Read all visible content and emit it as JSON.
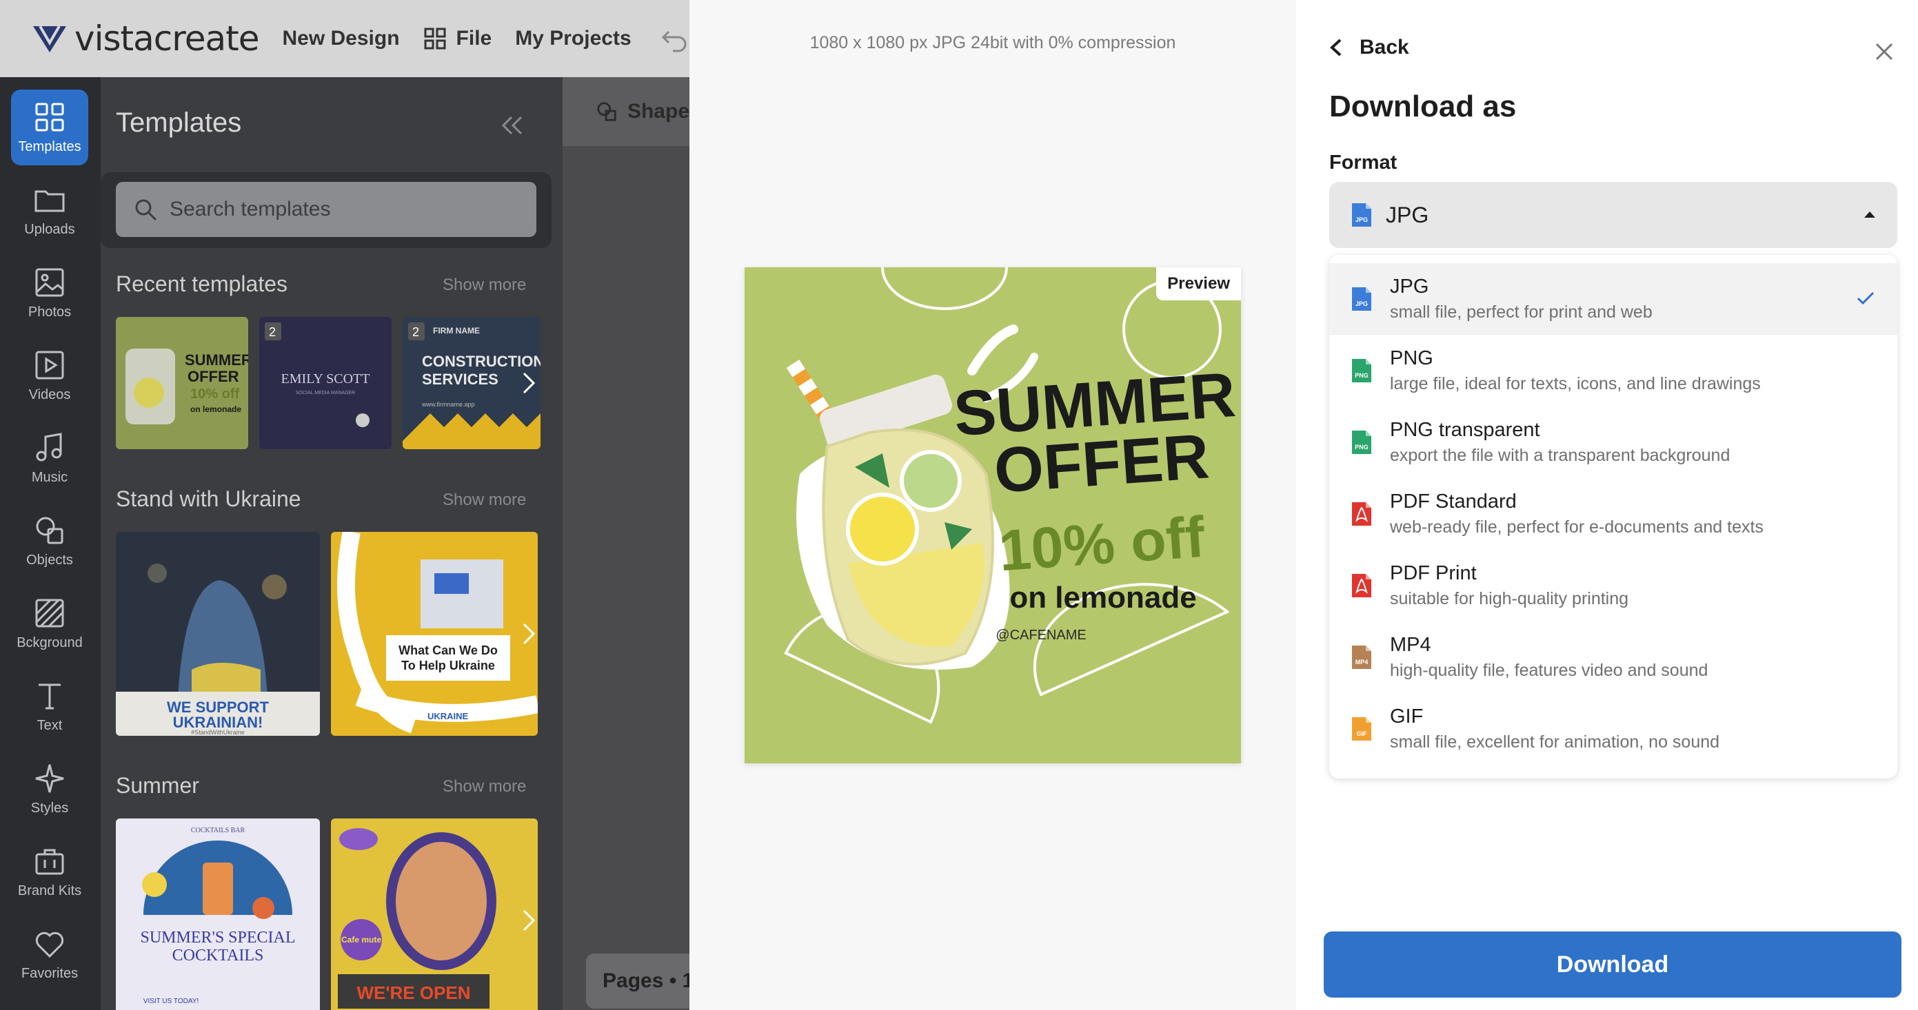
{
  "topbar": {
    "logo_text": "vistacreate",
    "new_design": "New Design",
    "file": "File",
    "my_projects": "My Projects"
  },
  "rail": [
    {
      "label": "Templates",
      "icon": "templates-icon",
      "active": true
    },
    {
      "label": "Uploads",
      "icon": "folder-icon"
    },
    {
      "label": "Photos",
      "icon": "photo-icon"
    },
    {
      "label": "Videos",
      "icon": "video-icon"
    },
    {
      "label": "Music",
      "icon": "music-icon"
    },
    {
      "label": "Objects",
      "icon": "objects-icon"
    },
    {
      "label": "Bckground",
      "icon": "background-icon"
    },
    {
      "label": "Text",
      "icon": "text-icon"
    },
    {
      "label": "Styles",
      "icon": "styles-icon"
    },
    {
      "label": "Brand Kits",
      "icon": "brand-kit-icon"
    },
    {
      "label": "Favorites",
      "icon": "heart-icon"
    }
  ],
  "templates_panel": {
    "title": "Templates",
    "search_placeholder": "Search templates",
    "sections": [
      {
        "title": "Recent templates",
        "show_more": "Show more"
      },
      {
        "title": "Stand with Ukraine",
        "show_more": "Show more"
      },
      {
        "title": "Summer",
        "show_more": "Show more"
      }
    ],
    "recent": [
      {
        "lines": [
          "SUMMER",
          "OFFER",
          "10% off",
          "on lemonade"
        ]
      },
      {
        "badge": "2",
        "title": "EMILY SCOTT",
        "subtitle": "SOCIAL MEDIA MANAGER"
      },
      {
        "badge": "2",
        "firm": "FIRM NAME",
        "title": "CONSTRUCTION",
        "title2": "SERVICES",
        "url": "www.firmname.app"
      }
    ],
    "ukraine": [
      {
        "caption": "WE SUPPORT",
        "caption2": "UKRAINIAN!",
        "tag": "#StandWithUkraine"
      },
      {
        "caption": "What Can We Do",
        "caption2": "To Help Ukraine",
        "band": "UKRAINE"
      }
    ],
    "summer": [
      {
        "tag": "COCKTAILS BAR",
        "title": "SUMMER'S SPECIAL",
        "title2": "COCKTAILS",
        "cta": "VISIT US TODAY!"
      },
      {
        "badge": "Cafe mute",
        "title": "WE'RE OPEN"
      }
    ]
  },
  "workspace": {
    "shape_label": "Shape",
    "pages_label": "Pages • 1"
  },
  "preview": {
    "spec": "1080 x 1080 px JPG 24bit with 0% compression",
    "badge": "Preview",
    "design": {
      "line1": "SUMMER",
      "line2": "OFFER",
      "line3": "10% off",
      "line4": "on lemonade",
      "handle": "@CAFENAME"
    }
  },
  "download_panel": {
    "back": "Back",
    "title": "Download as",
    "format_label": "Format",
    "selected": "JPG",
    "options": [
      {
        "name": "JPG",
        "desc": "small file, perfect for print and web",
        "icon": "jpg-file-icon",
        "color": "#3b7dd8",
        "tag": "JPG",
        "selected": true
      },
      {
        "name": "PNG",
        "desc": "large file, ideal for texts, icons, and line drawings",
        "icon": "png-file-icon",
        "color": "#2aa56b",
        "tag": "PNG"
      },
      {
        "name": "PNG transparent",
        "desc": "export the file with a transparent background",
        "icon": "png-transparent-file-icon",
        "color": "#2aa56b",
        "tag": "PNG"
      },
      {
        "name": "PDF Standard",
        "desc": "web-ready file, perfect for e-documents and texts",
        "icon": "pdf-file-icon",
        "color": "#e0342e",
        "tag": ""
      },
      {
        "name": "PDF Print",
        "desc": "suitable for high-quality printing",
        "icon": "pdf-print-file-icon",
        "color": "#e0342e",
        "tag": ""
      },
      {
        "name": "MP4",
        "desc": "high-quality file, features video and sound",
        "icon": "mp4-file-icon",
        "color": "#b58255",
        "tag": "MP4"
      },
      {
        "name": "GIF",
        "desc": "small file, excellent for animation, no sound",
        "icon": "gif-file-icon",
        "color": "#f0a030",
        "tag": "GIF"
      }
    ],
    "download_button": "Download"
  },
  "colors": {
    "accent": "#2f72c9",
    "rail_bg": "#2b2c30",
    "panel_bg": "#3c3d41",
    "preview_green": "#b5c76b"
  }
}
